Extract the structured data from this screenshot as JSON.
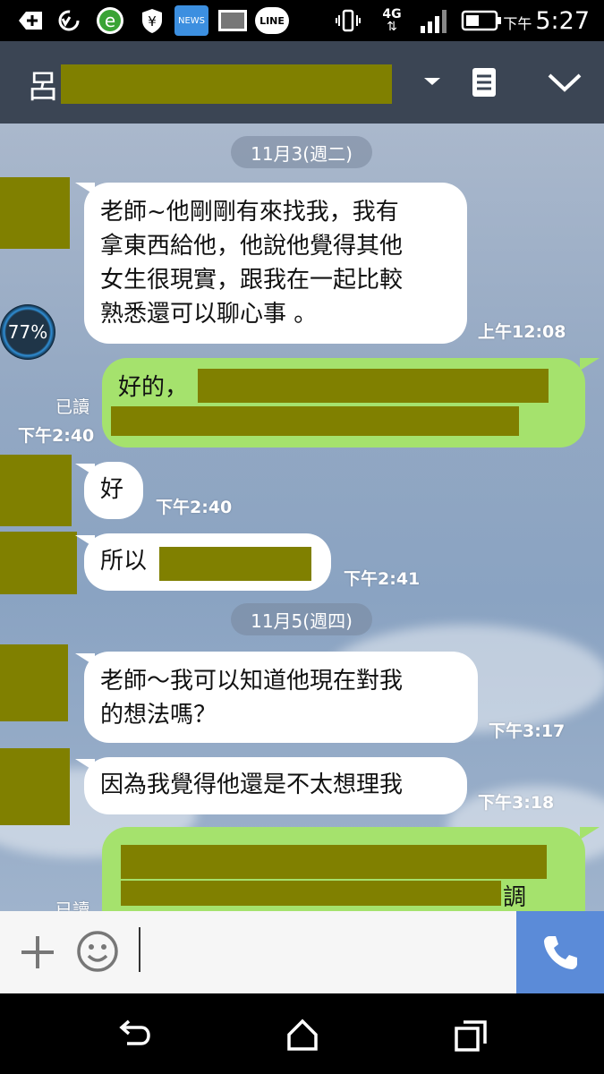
{
  "status_bar": {
    "time_prefix": "下午",
    "time": "5:27",
    "news_label": "NEWS",
    "line_label": "LINE",
    "network_label": "4G"
  },
  "header": {
    "name_char": "呂"
  },
  "chat": {
    "date1": "11月3(週二)",
    "date2": "11月5(週四)",
    "battery_badge": "77%",
    "messages": [
      {
        "text": "老師~他剛剛有來找我，我有\n拿東西給他，他說他覺得其他\n女生很現實，跟我在一起比較\n熟悉還可以聊心事 。",
        "time": "上午12:08"
      },
      {
        "text": "好的，",
        "time": "下午2:40",
        "read": "已讀"
      },
      {
        "text": "好",
        "time": "下午2:40"
      },
      {
        "text": "所以",
        "time": "下午2:41"
      },
      {
        "text": "老師～我可以知道他現在對我\n的想法嗎？",
        "time": "下午3:17"
      },
      {
        "text": "因為我覺得他還是不太想理我",
        "time": "下午3:18"
      },
      {
        "text": "調",
        "read": "已讀"
      }
    ]
  },
  "colors": {
    "header_bg": "#3b4554",
    "outgoing_bubble": "#a5e26d",
    "incoming_bubble": "#ffffff",
    "call_button": "#5b8bd8",
    "redaction": "#808000"
  }
}
